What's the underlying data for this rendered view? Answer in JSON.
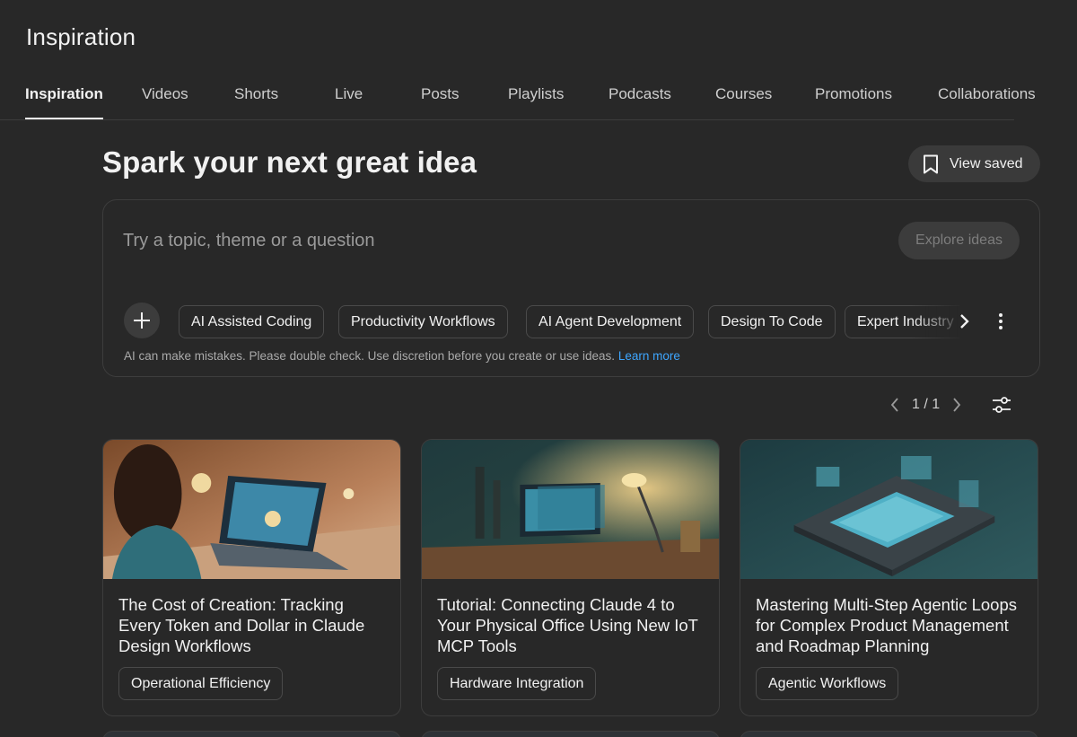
{
  "header": {
    "title": "Inspiration"
  },
  "tabs": [
    {
      "label": "Inspiration",
      "active": true
    },
    {
      "label": "Videos"
    },
    {
      "label": "Shorts"
    },
    {
      "label": "Live"
    },
    {
      "label": "Posts"
    },
    {
      "label": "Playlists"
    },
    {
      "label": "Podcasts"
    },
    {
      "label": "Courses"
    },
    {
      "label": "Promotions"
    },
    {
      "label": "Collaborations"
    }
  ],
  "main": {
    "headline": "Spark your next great idea",
    "view_saved_label": "View saved",
    "idea_input": {
      "placeholder": "Try a topic, theme or a question",
      "value": ""
    },
    "explore_label": "Explore ideas",
    "chips": [
      "AI Assisted Coding",
      "Productivity Workflows",
      "AI Agent Development",
      "Design To Code",
      "Expert Industry"
    ],
    "disclaimer": "AI can make mistakes. Please double check. Use discretion before you create or use ideas.",
    "learn_more": "Learn more",
    "pager": {
      "text": "1 / 1"
    }
  },
  "cards": [
    {
      "title": "The Cost of Creation: Tracking Every Token and Dollar in Claude Design Workflows",
      "tag": "Operational Efficiency"
    },
    {
      "title": "Tutorial: Connecting Claude 4 to Your Physical Office Using New IoT MCP Tools",
      "tag": "Hardware Integration"
    },
    {
      "title": "Mastering Multi-Step Agentic Loops for Complex Product Management and Roadmap Planning",
      "tag": "Agentic Workflows"
    }
  ],
  "icons": {
    "view_saved": "bookmark-icon",
    "add": "plus-icon",
    "chips_next": "chevron-right-icon",
    "more": "more-vert-icon",
    "prev": "chevron-left-icon",
    "next": "chevron-right-icon",
    "filter": "tune-icon"
  },
  "colors": {
    "background": "#282828",
    "link": "#3ea6ff",
    "text": "#f1f1f1"
  }
}
